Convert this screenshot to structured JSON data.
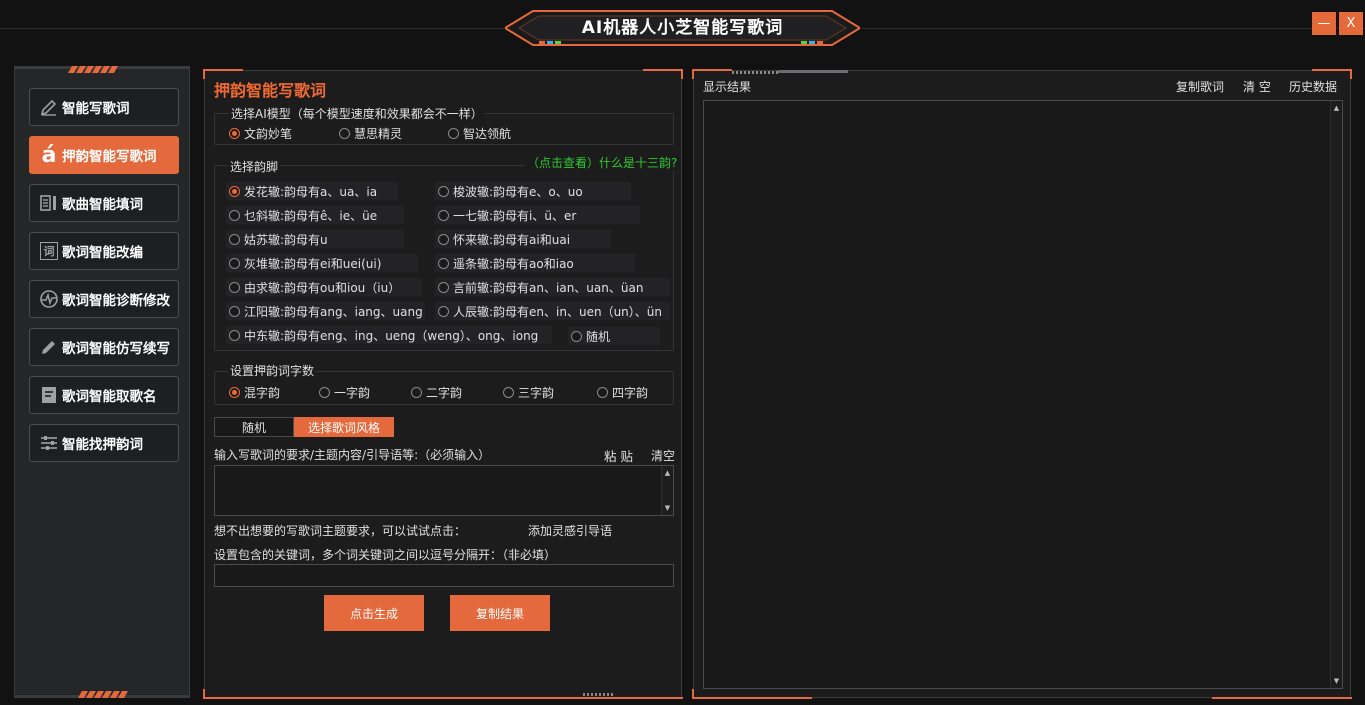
{
  "app": {
    "title": "AI机器人小芝智能写歌词",
    "minimize_label": "—",
    "close_label": "X"
  },
  "sidebar": {
    "items": [
      {
        "label": "智能写歌词",
        "icon": "pen-icon",
        "active": false
      },
      {
        "label": "押韵智能写歌词",
        "icon": "letter-a-icon",
        "active": true
      },
      {
        "label": "歌曲智能填词",
        "icon": "list-icon",
        "active": false
      },
      {
        "label": "歌词智能改编",
        "icon": "ci-char-icon",
        "active": false
      },
      {
        "label": "歌词智能诊断修改",
        "icon": "pulse-icon",
        "active": false
      },
      {
        "label": "歌词智能仿写续写",
        "icon": "edit-icon",
        "active": false
      },
      {
        "label": "歌词智能取歌名",
        "icon": "document-icon",
        "active": false
      },
      {
        "label": "智能找押韵词",
        "icon": "sliders-icon",
        "active": false
      }
    ]
  },
  "main": {
    "title": "押韵智能写歌词",
    "model_group": {
      "label": "选择AI模型（每个模型速度和效果都会不一样）",
      "options": [
        "文韵妙笔",
        "慧思精灵",
        "智达领航"
      ],
      "selected": 0
    },
    "rhyme_group": {
      "label": "选择韵脚",
      "help_link": "（点击查看）什么是十三韵?",
      "options": [
        "发花辙:韵母有a、ua、ia",
        "梭波辙:韵母有e、o、uo",
        "乜斜辙:韵母有ê、ie、üe",
        "一七辙:韵母有i、ü、er",
        "姑苏辙:韵母有u",
        "怀来辙:韵母有ai和uai",
        "灰堆辙:韵母有ei和uei(ui)",
        "遥条辙:韵母有ao和iao",
        "由求辙:韵母有ou和iou（iu）",
        "言前辙:韵母有an、ian、uan、üan",
        "江阳辙:韵母有ang、iang、uang",
        "人辰辙:韵母有en、in、uen（un）、ün",
        "中东辙:韵母有eng、ing、ueng（weng）、ong、iong",
        "随机"
      ],
      "selected": 0
    },
    "count_group": {
      "label": "设置押韵词字数",
      "options": [
        "混字韵",
        "一字韵",
        "二字韵",
        "三字韵",
        "四字韵"
      ],
      "selected": 0
    },
    "style": {
      "value": "随机",
      "button_label": "选择歌词风格"
    },
    "requirement": {
      "label": "输入写歌词的要求/主题内容/引导语等:（必须输入）",
      "paste_label": "粘 贴",
      "clear_label": "清空",
      "value": ""
    },
    "inspiration": {
      "hint": "想不出想要的写歌词主题要求，可以试试点击：",
      "link": "添加灵感引导语"
    },
    "keywords": {
      "label": "设置包含的关键词，多个词关键词之间以逗号分隔开：（非必填）",
      "value": ""
    },
    "generate_label": "点击生成",
    "copy_label": "复制结果"
  },
  "result": {
    "label": "显示结果",
    "copy_lyrics": "复制歌词",
    "clear": "清 空",
    "history": "历史数据",
    "content": ""
  },
  "colors": {
    "accent": "#e4693c",
    "link_green": "#30c82e",
    "background": "#121212"
  }
}
